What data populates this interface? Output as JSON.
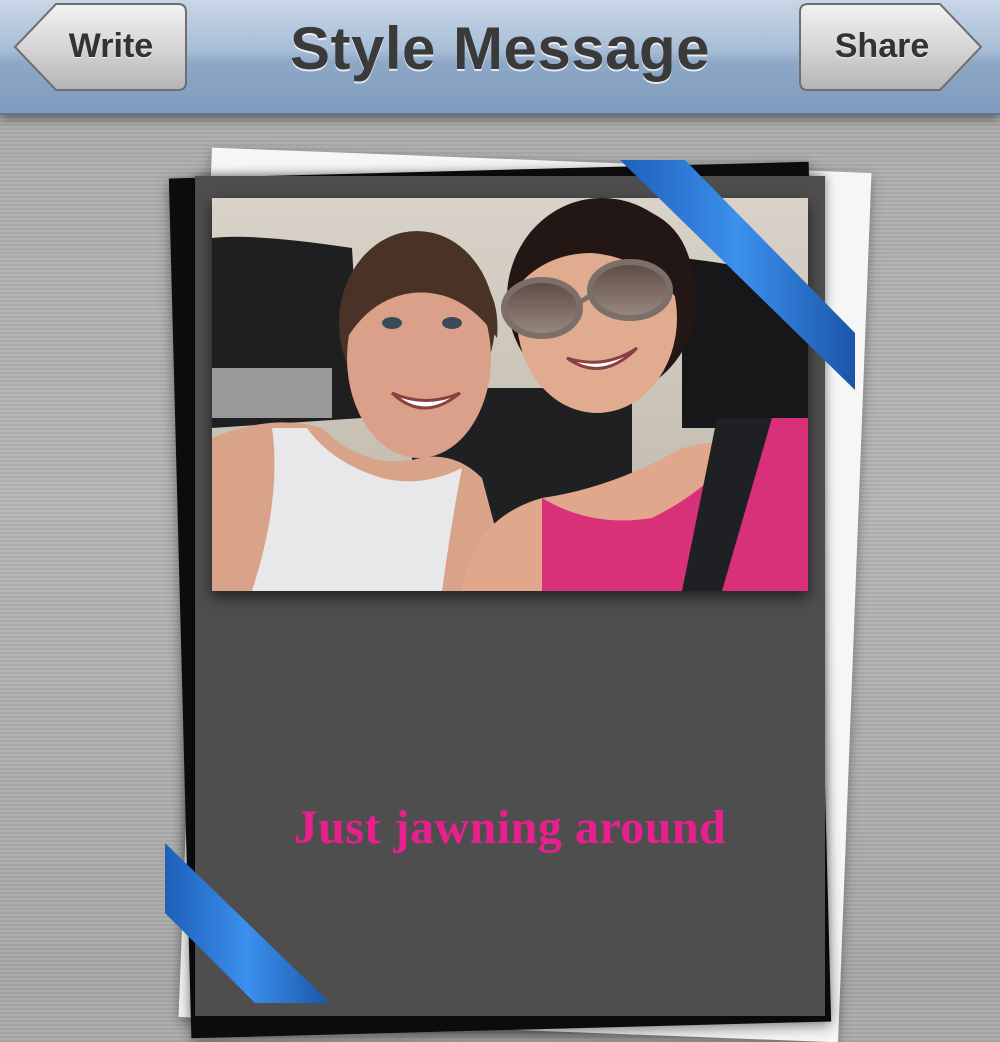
{
  "navbar": {
    "title": "Style Message",
    "back_label": "Write",
    "share_label": "Share"
  },
  "card": {
    "caption": "Just jawning around",
    "caption_color": "#ea1f8e",
    "ribbon_color": "#2f7fe0"
  }
}
